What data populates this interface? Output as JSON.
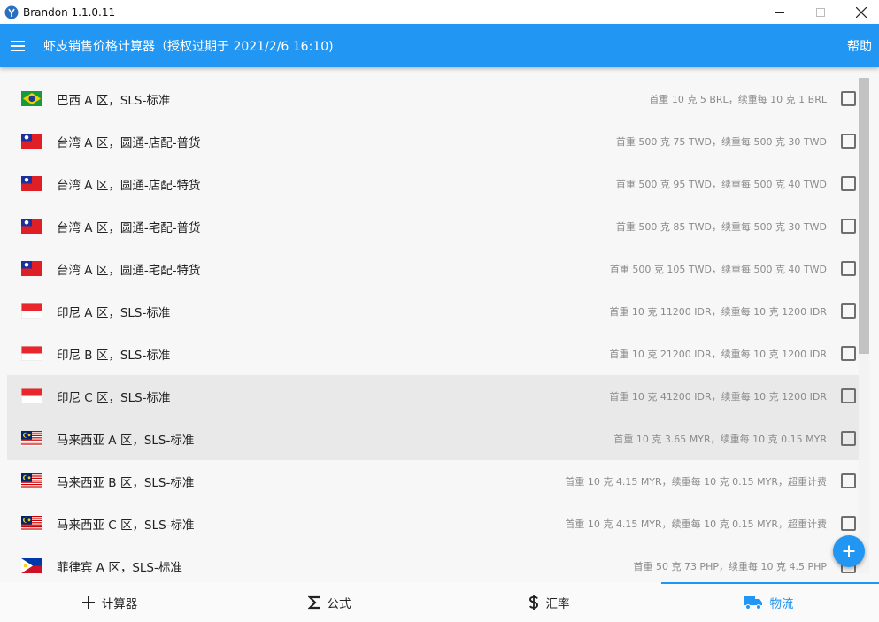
{
  "window": {
    "title": "Brandon 1.1.0.11"
  },
  "appbar": {
    "title": "虾皮销售价格计算器（授权过期于 2021/2/6 16:10)",
    "help_label": "帮助"
  },
  "colors": {
    "primary": "#2196f3",
    "text": "#222222",
    "muted": "#8a8a8a"
  },
  "list": {
    "rows": [
      {
        "label": "巴西 A 区，SLS-标准",
        "desc": "首重 10 克 5 BRL，续重每 10 克 1 BRL",
        "flag": "brazil-flag-icon",
        "checked": false
      },
      {
        "label": "台湾 A 区，圆通-店配-普货",
        "desc": "首重 500 克 75 TWD，续重每 500 克 30 TWD",
        "flag": "taiwan-flag-icon",
        "checked": false
      },
      {
        "label": "台湾 A 区，圆通-店配-特货",
        "desc": "首重 500 克 95 TWD，续重每 500 克 40 TWD",
        "flag": "taiwan-flag-icon",
        "checked": false
      },
      {
        "label": "台湾 A 区，圆通-宅配-普货",
        "desc": "首重 500 克 85 TWD，续重每 500 克 30 TWD",
        "flag": "taiwan-flag-icon",
        "checked": false
      },
      {
        "label": "台湾 A 区，圆通-宅配-特货",
        "desc": "首重 500 克 105 TWD，续重每 500 克 40 TWD",
        "flag": "taiwan-flag-icon",
        "checked": false
      },
      {
        "label": "印尼 A 区，SLS-标准",
        "desc": "首重 10 克 11200 IDR，续重每 10 克 1200 IDR",
        "flag": "indonesia-flag-icon",
        "checked": false
      },
      {
        "label": "印尼 B 区，SLS-标准",
        "desc": "首重 10 克 21200 IDR，续重每 10 克 1200 IDR",
        "flag": "indonesia-flag-icon",
        "checked": false
      },
      {
        "label": "印尼 C 区，SLS-标准",
        "desc": "首重 10 克 41200 IDR，续重每 10 克 1200 IDR",
        "flag": "indonesia-flag-icon",
        "checked": false
      },
      {
        "label": "马来西亚 A 区，SLS-标准",
        "desc": "首重 10 克 3.65 MYR，续重每 10 克 0.15 MYR",
        "flag": "malaysia-flag-icon",
        "checked": false
      },
      {
        "label": "马来西亚 B 区，SLS-标准",
        "desc": "首重 10 克 4.15 MYR，续重每 10 克 0.15 MYR，超重计费",
        "flag": "malaysia-flag-icon",
        "checked": false
      },
      {
        "label": "马来西亚 C 区，SLS-标准",
        "desc": "首重 10 克 4.15 MYR，续重每 10 克 0.15 MYR，超重计费",
        "flag": "malaysia-flag-icon",
        "checked": false
      },
      {
        "label": "菲律宾 A 区，SLS-标准",
        "desc": "首重 50 克 73 PHP，续重每 10 克 4.5 PHP",
        "flag": "philippines-flag-icon",
        "checked": false
      }
    ]
  },
  "tabs": [
    {
      "label": "计算器",
      "icon": "plus-icon",
      "active": false
    },
    {
      "label": "公式",
      "icon": "sigma-icon",
      "active": false
    },
    {
      "label": "汇率",
      "icon": "dollar-icon",
      "active": false
    },
    {
      "label": "物流",
      "icon": "truck-icon",
      "active": true
    }
  ],
  "fab": {
    "icon": "add-icon"
  }
}
